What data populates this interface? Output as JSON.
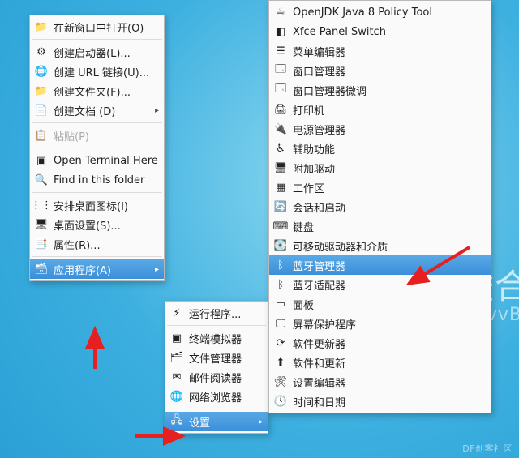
{
  "bg": {
    "ghost1": "虚合",
    "ghost2": "vvB"
  },
  "watermark": "DF创客社区",
  "menu1": {
    "open_new_window": "在新窗口中打开(O)",
    "create_launcher": "创建启动器(L)...",
    "create_url": "创建 URL 链接(U)...",
    "create_folder": "创建文件夹(F)...",
    "create_document": "创建文档 (D)",
    "paste": "粘贴(P)",
    "open_terminal": "Open Terminal Here",
    "find_folder": "Find in this folder",
    "arrange_icons": "安排桌面图标(I)",
    "desktop_settings": "桌面设置(S)...",
    "properties": "属性(R)...",
    "applications": "应用程序(A)"
  },
  "menu2": {
    "run_program": "运行程序...",
    "terminal_emulator": "终端模拟器",
    "file_manager": "文件管理器",
    "mail_reader": "邮件阅读器",
    "web_browser": "网络浏览器",
    "settings": "设置"
  },
  "menu3": {
    "openjdk": "OpenJDK Java 8 Policy Tool",
    "xfce_panel": "Xfce Panel Switch",
    "menu_editor": "菜单编辑器",
    "window_manager": "窗口管理器",
    "window_manager_tweaks": "窗口管理器微调",
    "printers": "打印机",
    "power_manager": "电源管理器",
    "accessibility": "辅助功能",
    "additional_drivers": "附加驱动",
    "workspaces": "工作区",
    "session_startup": "会话和启动",
    "keyboard": "键盘",
    "removable_drives": "可移动驱动器和介质",
    "bluetooth_manager": "蓝牙管理器",
    "bluetooth_adapters": "蓝牙适配器",
    "panel": "面板",
    "screensaver": "屏幕保护程序",
    "software_updater": "软件更新器",
    "software_updates": "软件和更新",
    "settings_editor": "设置编辑器",
    "date_time": "时间和日期"
  }
}
